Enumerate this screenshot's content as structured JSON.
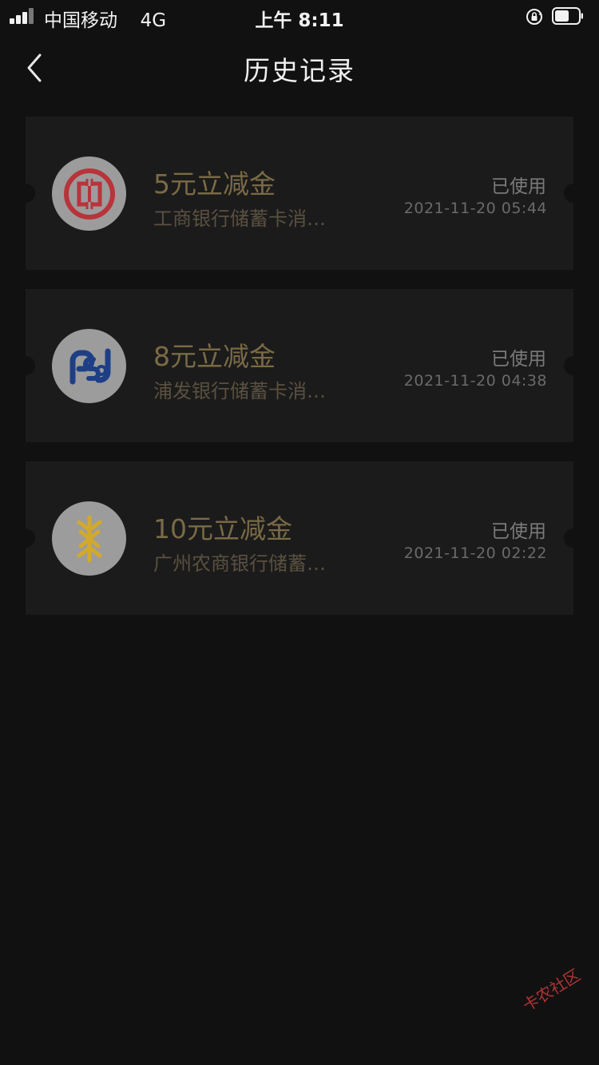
{
  "status_bar": {
    "carrier": "中国移动",
    "network": "4G",
    "time": "上午 8:11"
  },
  "nav": {
    "title": "历史记录"
  },
  "coupons": [
    {
      "title": "5元立减金",
      "description": "工商银行储蓄卡消…",
      "status": "已使用",
      "date": "2021-11-20 05:44",
      "bank_icon": "icbc-logo-icon"
    },
    {
      "title": "8元立减金",
      "description": "浦发银行储蓄卡消…",
      "status": "已使用",
      "date": "2021-11-20 04:38",
      "bank_icon": "spdb-logo-icon"
    },
    {
      "title": "10元立减金",
      "description": "广州农商银行储蓄…",
      "status": "已使用",
      "date": "2021-11-20 02:22",
      "bank_icon": "grcb-logo-icon"
    }
  ],
  "watermark": {
    "text": "卡农社区"
  },
  "colors": {
    "background": "#111111",
    "card": "#1b1b1b",
    "coupon_title": "#7a6a45",
    "icbc_red": "#c0282d",
    "spdb_blue": "#1e3f86",
    "grcb_gold": "#d9b02c"
  }
}
